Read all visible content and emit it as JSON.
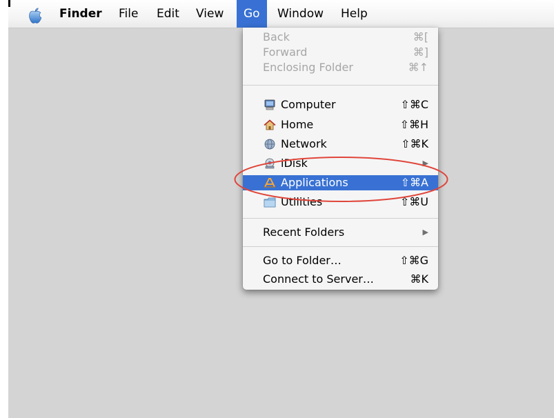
{
  "menubar": {
    "apple_icon": "apple-logo-icon",
    "items": [
      {
        "label": "Finder"
      },
      {
        "label": "File"
      },
      {
        "label": "Edit"
      },
      {
        "label": "View"
      },
      {
        "label": "Go"
      },
      {
        "label": "Window"
      },
      {
        "label": "Help"
      }
    ]
  },
  "go_menu": {
    "items": [
      {
        "label": "Back",
        "shortcut": "⌘[",
        "enabled": false
      },
      {
        "label": "Forward",
        "shortcut": "⌘]",
        "enabled": false
      },
      {
        "label": "Enclosing Folder",
        "shortcut": "⌘↑",
        "enabled": false
      },
      {
        "label": "Computer",
        "shortcut": "⇧⌘C",
        "icon": "computer-icon"
      },
      {
        "label": "Home",
        "shortcut": "⇧⌘H",
        "icon": "home-icon"
      },
      {
        "label": "Network",
        "shortcut": "⇧⌘K",
        "icon": "network-icon"
      },
      {
        "label": "iDisk",
        "submenu_arrow": "▶",
        "icon": "idisk-icon"
      },
      {
        "label": "Applications",
        "shortcut": "⇧⌘A",
        "icon": "applications-icon",
        "highlighted": true
      },
      {
        "label": "Utilities",
        "shortcut": "⇧⌘U",
        "icon": "utilities-folder-icon"
      },
      {
        "label": "Recent Folders",
        "submenu_arrow": "▶"
      },
      {
        "label": "Go to Folder…",
        "shortcut": "⇧⌘G"
      },
      {
        "label": "Connect to Server…",
        "shortcut": "⌘K"
      }
    ]
  },
  "colors": {
    "highlight": "#3871d3",
    "desktop": "#d4d4d4",
    "annotation_oval": "#e0453a"
  }
}
